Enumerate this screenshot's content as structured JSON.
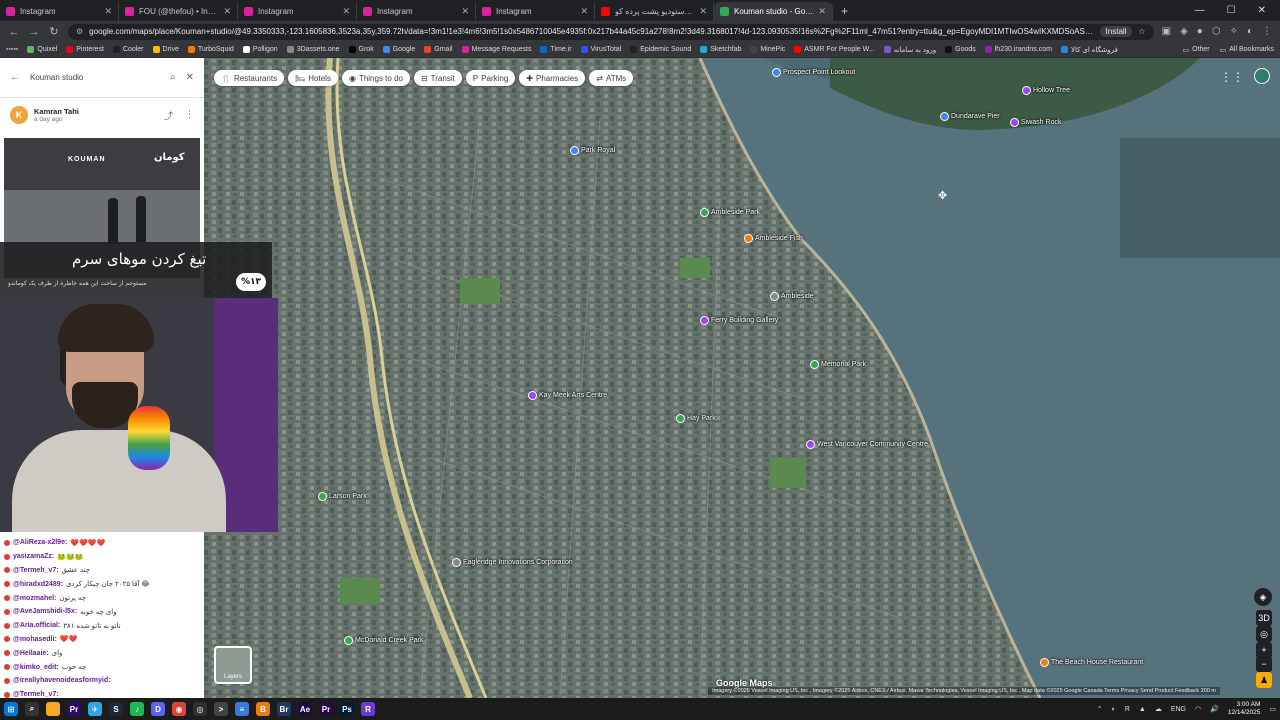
{
  "browser": {
    "tabs": [
      {
        "title": "Instagram",
        "fav": "#d6249f",
        "active": false
      },
      {
        "title": "FOU (@thefou) • Instagram ph...",
        "fav": "#d6249f",
        "active": false
      },
      {
        "title": "Instagram",
        "fav": "#d6249f",
        "active": false
      },
      {
        "title": "Instagram",
        "fav": "#d6249f",
        "active": false
      },
      {
        "title": "Instagram",
        "fav": "#d6249f",
        "active": false
      },
      {
        "title": "تور کامل استودیو پشت پرده کو...",
        "fav": "#ff0000",
        "active": false
      },
      {
        "title": "Kouman studio - Google Maps",
        "fav": "#34a853",
        "active": true
      }
    ],
    "new_tab": "+",
    "url": "google.com/maps/place/Kouman+studio/@49.3350333,-123.1605836,3523a,35y,359.72h/data=!3m1!1e3!4m6!3m5!1s0x5486710045e4935f:0x217b44a45c91a278!8m2!3d49.3168017!4d-123.0930535!16s%2Fg%2F11ml_47m51?entry=ttu&g_ep=EgoyMDI1MTIwOS4wIKXMDSoASAFQAw%3D%3D",
    "install_label": "Install",
    "bookmarks": [
      {
        "label": "Quixel",
        "color": "#5cb85c"
      },
      {
        "label": "Pinterest",
        "color": "#e60023"
      },
      {
        "label": "Cooler",
        "color": "#222"
      },
      {
        "label": "Drive",
        "color": "#fbbc04"
      },
      {
        "label": "TurboSquid",
        "color": "#f57c00"
      },
      {
        "label": "Polligon",
        "color": "#ffffff"
      },
      {
        "label": "3Dassets.one",
        "color": "#888"
      },
      {
        "label": "Grok",
        "color": "#000"
      },
      {
        "label": "Google",
        "color": "#4285f4"
      },
      {
        "label": "Gmail",
        "color": "#ea4335"
      },
      {
        "label": "Message Requests",
        "color": "#d6249f"
      },
      {
        "label": "Time.ir",
        "color": "#1565c0"
      },
      {
        "label": "VirusTotal",
        "color": "#394eff"
      },
      {
        "label": "Epidemic Sound",
        "color": "#222"
      },
      {
        "label": "Sketchfab",
        "color": "#1caad9"
      },
      {
        "label": "MinePic",
        "color": "#444"
      },
      {
        "label": "ASMR For People W...",
        "color": "#ff0000"
      },
      {
        "label": "ورود به سامانه",
        "color": "#7e57c2"
      },
      {
        "label": "Goods",
        "color": "#111"
      },
      {
        "label": "lh230.irandns.com",
        "color": "#8e24aa"
      },
      {
        "label": "فروشگاه ای کالا",
        "color": "#1e88e5"
      }
    ],
    "bookmarks_other": "Other",
    "bookmarks_all": "All Bookmarks"
  },
  "maps": {
    "search_query": "Kouman studio",
    "chips": [
      {
        "label": "Restaurants",
        "icon": "fork-icon"
      },
      {
        "label": "Hotels",
        "icon": "bed-icon"
      },
      {
        "label": "Things to do",
        "icon": "camera-icon"
      },
      {
        "label": "Transit",
        "icon": "bus-icon"
      },
      {
        "label": "Parking",
        "icon": "parking-icon"
      },
      {
        "label": "Pharmacies",
        "icon": "pill-icon"
      },
      {
        "label": "ATMs",
        "icon": "atm-icon"
      }
    ],
    "places": [
      {
        "name": "Prospect Point Lookout",
        "color": "#4285f4"
      },
      {
        "name": "Hollow Tree",
        "color": "#a142f4"
      },
      {
        "name": "Siwash Rock",
        "color": "#a142f4"
      },
      {
        "name": "Dundarave Pier",
        "color": "#4285f4"
      },
      {
        "name": "Ambleside Park",
        "color": "#34a853"
      },
      {
        "name": "Park Royal",
        "color": "#4285f4"
      },
      {
        "name": "Ambleside Fish",
        "color": "#f57c00"
      },
      {
        "name": "Ferry Building Gallery",
        "color": "#a142f4"
      },
      {
        "name": "Kay Meek Arts Centre",
        "color": "#a142f4"
      },
      {
        "name": "West Vancouver Community Centre",
        "color": "#a142f4"
      },
      {
        "name": "Memorial Park",
        "color": "#34a853"
      },
      {
        "name": "Hay Park",
        "color": "#34a853"
      },
      {
        "name": "Larson Park",
        "color": "#34a853"
      },
      {
        "name": "McDonald Creek Park",
        "color": "#34a853"
      },
      {
        "name": "Eagleridge Innovations Corporation",
        "color": "#888"
      },
      {
        "name": "The Beach House Restaurant",
        "color": "#f57c00"
      },
      {
        "name": "Ambleside",
        "color": "#888"
      }
    ],
    "layers_label": "Layers",
    "google_logo": "Google Maps",
    "attribution": "Imagery ©2025 Vexcel Imaging US, Inc., Imagery ©2025 Airbus, CNES / Airbus, Maxar Technologies, Vexcel Imaging US, Inc., Map data ©2025 Google   Canada   Terms   Privacy   Send Product Feedback   200 m",
    "review": {
      "avatar_letter": "K",
      "name": "Kamran Tahi",
      "date": "a day ago"
    },
    "photo_sign_left": "KOUMAN",
    "photo_sign_right": "کومان"
  },
  "overlay": {
    "caption_big": "تیغ کردن موهای سرم",
    "caption_small": "مستوجم از ساخت این همه خاطره از طرف یک کوماندو",
    "percent": "%۱۳"
  },
  "chat": [
    {
      "user": "@AliReza-x2l9e:",
      "text": "❤️❤️❤️❤️"
    },
    {
      "user": "yasizamaZz:",
      "text": "🐸🐸🐸"
    },
    {
      "user": "@Termeh_v7:",
      "text": "چند عشق"
    },
    {
      "user": "@hiradxd2489:",
      "text": "آقا ۲۰۲۵ جان چیکار کردی 😂"
    },
    {
      "user": "@mozmahel:",
      "text": "چه پرتون"
    },
    {
      "user": "@AveJamshidi-l5x:",
      "text": "وای چه خوبه"
    },
    {
      "user": "@Aria.official:",
      "text": "تاتو به تاتو شده ۳۸۱"
    },
    {
      "user": "@mohasedli:",
      "text": "❤️❤️"
    },
    {
      "user": "@Hellaaie:",
      "text": "وای"
    },
    {
      "user": "@kimko_edit:",
      "text": "چه خوب"
    },
    {
      "user": "@ireallyhavenoideasformyid:",
      "text": ""
    },
    {
      "user": "@Termeh_v7:",
      "text": ""
    }
  ],
  "taskbar": {
    "icons": [
      {
        "name": "windows-start-icon",
        "color": "#0078d4",
        "glyph": "⊞"
      },
      {
        "name": "search-icon",
        "color": "#333",
        "glyph": "⌕"
      },
      {
        "name": "file-explorer-icon",
        "color": "#f9a825",
        "glyph": ""
      },
      {
        "name": "premiere-icon",
        "color": "#2d0b6b",
        "glyph": "Pr"
      },
      {
        "name": "telegram-icon",
        "color": "#29a9eb",
        "glyph": "✈"
      },
      {
        "name": "steam-icon",
        "color": "#1b2838",
        "glyph": "S"
      },
      {
        "name": "spotify-icon",
        "color": "#1db954",
        "glyph": "♪"
      },
      {
        "name": "discord-icon",
        "color": "#5865f2",
        "glyph": "D"
      },
      {
        "name": "chrome-icon",
        "color": "#db4437",
        "glyph": "◉"
      },
      {
        "name": "obs-icon",
        "color": "#302e31",
        "glyph": "◎"
      },
      {
        "name": "terminal-icon",
        "color": "#444",
        "glyph": ">"
      },
      {
        "name": "notepad-icon",
        "color": "#3a7bd5",
        "glyph": "≡"
      },
      {
        "name": "blender-icon",
        "color": "#e87d0d",
        "glyph": "B"
      },
      {
        "name": "photoshop-bridge-icon",
        "color": "#1e3a5f",
        "glyph": "Br"
      },
      {
        "name": "after-effects-icon",
        "color": "#1f0a3f",
        "glyph": "Ae"
      },
      {
        "name": "premiere-pro-icon",
        "color": "#2a0845",
        "glyph": "Pr"
      },
      {
        "name": "photoshop-icon",
        "color": "#001e36",
        "glyph": "Ps"
      },
      {
        "name": "app-r-icon",
        "color": "#6a3bd1",
        "glyph": "R"
      }
    ],
    "lang": "ENG",
    "time": "3:00 AM",
    "date": "12/14/2025"
  }
}
